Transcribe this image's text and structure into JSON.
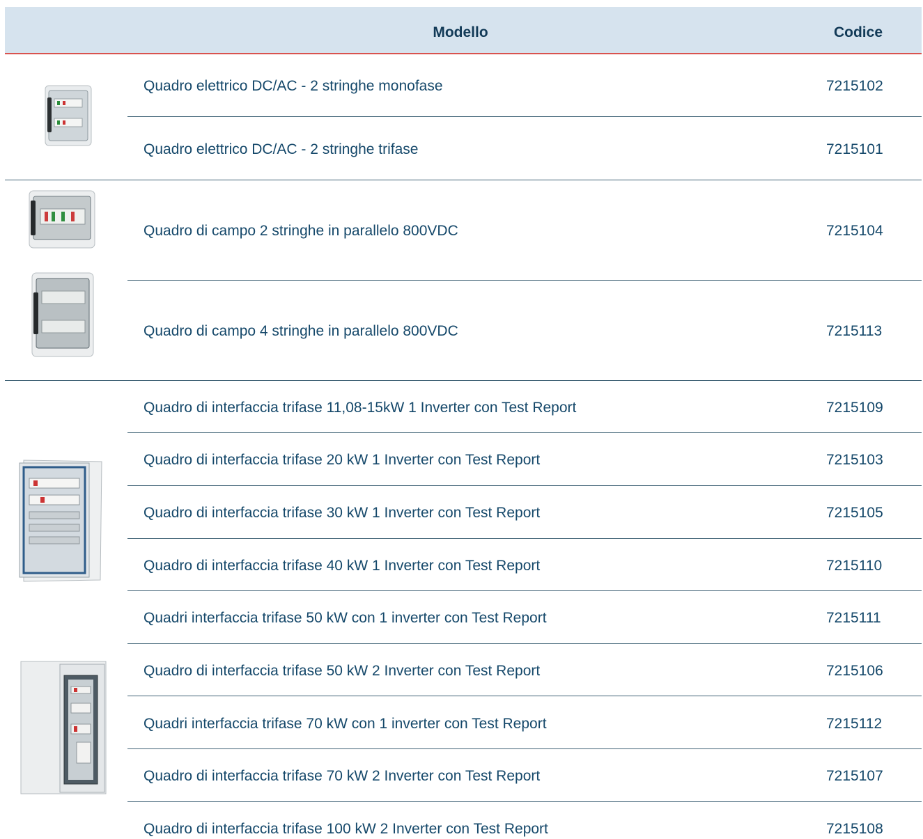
{
  "table": {
    "header": {
      "model_label": "Modello",
      "code_label": "Codice"
    },
    "groups": [
      {
        "image_icon": "small-enclosure-image",
        "rows": [
          {
            "model": "Quadro elettrico DC/AC - 2 stringhe monofase",
            "code": "7215102"
          },
          {
            "model": "Quadro elettrico DC/AC - 2 stringhe trifase",
            "code": "7215101"
          }
        ]
      },
      {
        "image_icon": "field-box-image",
        "rows": [
          {
            "model": "Quadro di campo 2 stringhe in parallelo 800VDC",
            "code": "7215104"
          },
          {
            "model": "Quadro di campo 4 stringhe in parallelo 800VDC",
            "code": "7215113"
          }
        ]
      },
      {
        "image_icon": "interface-cabinet-image",
        "rows": [
          {
            "model": "Quadro di interfaccia trifase 11,08-15kW 1 Inverter con Test Report",
            "code": "7215109"
          },
          {
            "model": "Quadro di interfaccia trifase 20 kW 1 Inverter con Test Report",
            "code": "7215103"
          },
          {
            "model": "Quadro di interfaccia trifase 30 kW 1 Inverter con Test Report",
            "code": "7215105"
          },
          {
            "model": "Quadro di interfaccia trifase 40 kW 1 Inverter con Test Report",
            "code": "7215110"
          },
          {
            "model": "Quadri interfaccia trifase 50 kW  con 1 inverter con Test Report",
            "code": "7215111"
          },
          {
            "model": "Quadro di interfaccia trifase 50 kW 2 Inverter con Test Report",
            "code": "7215106"
          },
          {
            "model": "Quadri interfaccia trifase 70 kW  con 1 inverter con Test Report",
            "code": "7215112"
          },
          {
            "model": "Quadro di interfaccia trifase 70 kW 2 Inverter con Test Report",
            "code": "7215107"
          },
          {
            "model": "Quadro di interfaccia trifase 100 kW 2 Inverter con Test Report",
            "code": "7215108"
          }
        ]
      }
    ]
  },
  "colors": {
    "header_bg": "#d6e3ee",
    "header_accent_line": "#d9534f",
    "text": "#15486a",
    "divider": "#3f6275"
  }
}
